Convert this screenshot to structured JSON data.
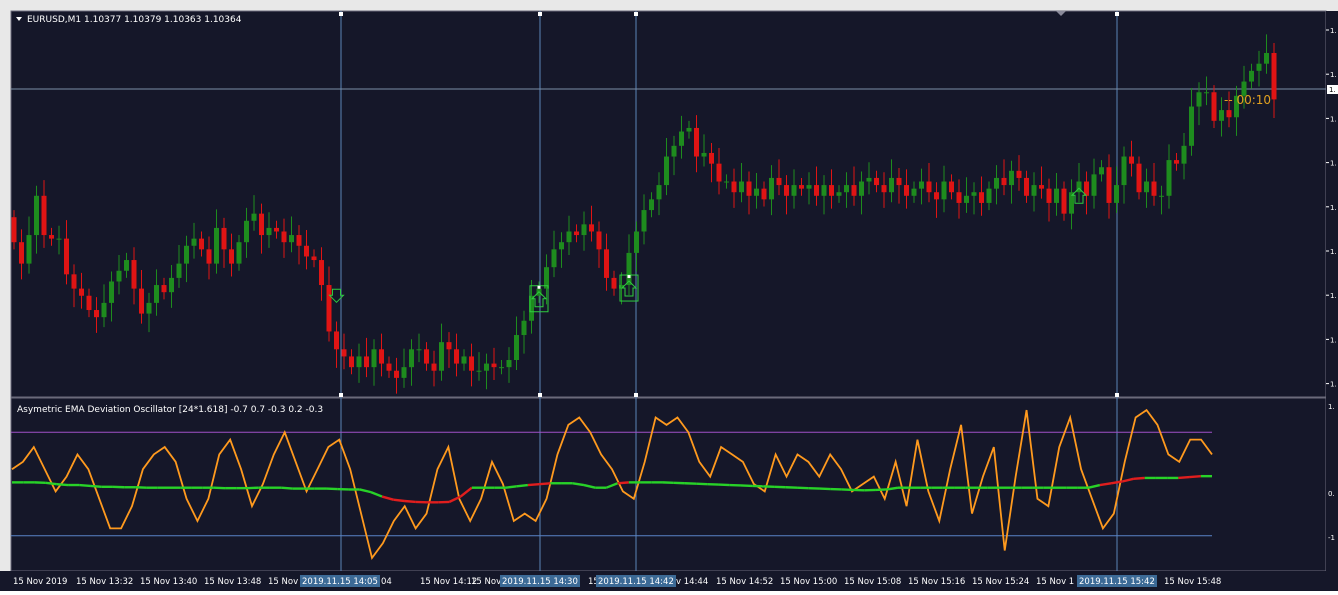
{
  "main_header": {
    "symbol": "EURUSD,M1",
    "ohlc": "1.10377 1.10379 1.10363 1.10364",
    "countdown": "-- 00:10"
  },
  "indicator_header": {
    "text": "Asymetric EMA Deviation Oscillator [24*1.618] -0.7 0.7 -0.3 0.2 -0.3"
  },
  "price_axis_labels": [
    "1.",
    "1.",
    "1.",
    "1.",
    "1.",
    "1.",
    "1.",
    "1.",
    "1."
  ],
  "current_price_label": "1.",
  "osc_axis_labels": [
    "1.",
    "0.",
    "-1"
  ],
  "time_labels": [
    "15 Nov 2019",
    "15 Nov 13:32",
    "15 Nov 13:40",
    "15 Nov 13:48",
    "15 Nov",
    "04",
    "15 Nov 14:12",
    "15 Nov 14",
    "15",
    "v 14:44",
    "15 Nov 14:52",
    "15 Nov 15:00",
    "15 Nov 15:08",
    "15 Nov 15:16",
    "15 Nov 15:24",
    "15 Nov 1",
    "15 Nov 15:48"
  ],
  "time_highlights": [
    "2019.11.15 14:05",
    "2019.11.15 14:30",
    "2019.11.15 14:42",
    "2019.11.15 15:42"
  ],
  "colors": {
    "background": "#151729",
    "bull": "#1e8c1e",
    "bear": "#e01414",
    "grid_line": "#5a84b8",
    "oscillator_fast": "#ff9a1e",
    "oscillator_slow_up": "#28d228",
    "oscillator_slow_down": "#e01e1e",
    "upper_level": "#a050c8",
    "lower_level": "#5a84c8",
    "arrow_up": "#2ecc40",
    "countdown": "#e0a020"
  },
  "chart_data": [
    {
      "type": "candlestick",
      "title": "EURUSD,M1",
      "y_relative_range": [
        0,
        1
      ],
      "note_units": "relative price, 0 = bottom of visible pane, 1 = top",
      "open": [
        0.47,
        0.4,
        0.34,
        0.42,
        0.53,
        0.42,
        0.41,
        0.41,
        0.31,
        0.27,
        0.25,
        0.21,
        0.19,
        0.23,
        0.29,
        0.32,
        0.35,
        0.27,
        0.2,
        0.23,
        0.28,
        0.26,
        0.3,
        0.34,
        0.39,
        0.41,
        0.38,
        0.34,
        0.44,
        0.38,
        0.34,
        0.4,
        0.46,
        0.48,
        0.42,
        0.44,
        0.43,
        0.4,
        0.42,
        0.39,
        0.36,
        0.35,
        0.28,
        0.15,
        0.1,
        0.08,
        0.05,
        0.08,
        0.05,
        0.1,
        0.06,
        0.04,
        0.02,
        0.05,
        0.1,
        0.1,
        0.06,
        0.04,
        0.12,
        0.1,
        0.06,
        0.08,
        0.04,
        0.04,
        0.06,
        0.05,
        0.05,
        0.07,
        0.14,
        0.18,
        0.25,
        0.27,
        0.33,
        0.38,
        0.4,
        0.43,
        0.42,
        0.45,
        0.43,
        0.38,
        0.3,
        0.27,
        0.28,
        0.37,
        0.43,
        0.49,
        0.52,
        0.56,
        0.64,
        0.67,
        0.71,
        0.72,
        0.64,
        0.65,
        0.62,
        0.57,
        0.57,
        0.54,
        0.57,
        0.53,
        0.55,
        0.52,
        0.58,
        0.56,
        0.53,
        0.56,
        0.55,
        0.56,
        0.53,
        0.56,
        0.53,
        0.54,
        0.56,
        0.53,
        0.57,
        0.58,
        0.56,
        0.54,
        0.58,
        0.56,
        0.53,
        0.55,
        0.57,
        0.54,
        0.52,
        0.57,
        0.54,
        0.51,
        0.53,
        0.54,
        0.51,
        0.55,
        0.58,
        0.56,
        0.6,
        0.58,
        0.53,
        0.56,
        0.55,
        0.51,
        0.55,
        0.48,
        0.54,
        0.57,
        0.53,
        0.59,
        0.61,
        0.51,
        0.56,
        0.64,
        0.62,
        0.54,
        0.57,
        0.53,
        0.53,
        0.63,
        0.62,
        0.67,
        0.78,
        0.82,
        0.82,
        0.74,
        0.77,
        0.75,
        0.81,
        0.85,
        0.88,
        0.9,
        0.93
      ],
      "close": [
        0.4,
        0.34,
        0.42,
        0.53,
        0.42,
        0.41,
        0.41,
        0.31,
        0.27,
        0.25,
        0.21,
        0.19,
        0.23,
        0.29,
        0.32,
        0.35,
        0.27,
        0.2,
        0.23,
        0.28,
        0.26,
        0.3,
        0.34,
        0.39,
        0.41,
        0.38,
        0.34,
        0.44,
        0.38,
        0.34,
        0.4,
        0.46,
        0.48,
        0.42,
        0.44,
        0.43,
        0.4,
        0.42,
        0.39,
        0.36,
        0.35,
        0.28,
        0.15,
        0.1,
        0.08,
        0.05,
        0.08,
        0.05,
        0.1,
        0.06,
        0.04,
        0.02,
        0.05,
        0.1,
        0.1,
        0.06,
        0.04,
        0.12,
        0.1,
        0.06,
        0.08,
        0.04,
        0.04,
        0.06,
        0.05,
        0.05,
        0.07,
        0.14,
        0.18,
        0.25,
        0.27,
        0.33,
        0.38,
        0.4,
        0.43,
        0.42,
        0.45,
        0.43,
        0.38,
        0.3,
        0.27,
        0.28,
        0.37,
        0.43,
        0.49,
        0.52,
        0.56,
        0.64,
        0.67,
        0.71,
        0.72,
        0.64,
        0.65,
        0.62,
        0.57,
        0.57,
        0.54,
        0.57,
        0.53,
        0.55,
        0.52,
        0.58,
        0.56,
        0.53,
        0.56,
        0.55,
        0.56,
        0.53,
        0.56,
        0.53,
        0.54,
        0.56,
        0.53,
        0.57,
        0.58,
        0.56,
        0.54,
        0.58,
        0.56,
        0.53,
        0.55,
        0.57,
        0.54,
        0.52,
        0.57,
        0.54,
        0.51,
        0.53,
        0.54,
        0.51,
        0.55,
        0.58,
        0.56,
        0.6,
        0.58,
        0.53,
        0.56,
        0.55,
        0.51,
        0.55,
        0.48,
        0.54,
        0.57,
        0.53,
        0.59,
        0.61,
        0.51,
        0.56,
        0.64,
        0.62,
        0.54,
        0.57,
        0.53,
        0.53,
        0.63,
        0.62,
        0.67,
        0.78,
        0.82,
        0.82,
        0.74,
        0.77,
        0.75,
        0.81,
        0.85,
        0.88,
        0.9,
        0.93,
        0.8
      ],
      "markers": [
        {
          "type": "arrow-down",
          "bar": 43
        },
        {
          "type": "arrow-up-boxed",
          "bar": 70
        },
        {
          "type": "arrow-up-boxed",
          "bar": 82
        },
        {
          "type": "arrow-up",
          "bar": 142
        }
      ]
    },
    {
      "type": "line",
      "title": "Asymetric EMA Deviation Oscillator [24*1.618]",
      "ylim": [
        -1,
        1
      ],
      "levels": [
        0.7,
        -0.7
      ],
      "series": [
        {
          "values": [
            0.2,
            0.3,
            0.5,
            0.2,
            -0.1,
            0.1,
            0.4,
            0.2,
            -0.2,
            -0.6,
            -0.6,
            -0.3,
            0.2,
            0.4,
            0.5,
            0.3,
            -0.2,
            -0.5,
            -0.2,
            0.4,
            0.6,
            0.2,
            -0.3,
            0.0,
            0.4,
            0.7,
            0.3,
            -0.1,
            0.2,
            0.5,
            0.6,
            0.2,
            -0.4,
            -1.0,
            -0.8,
            -0.5,
            -0.3,
            -0.6,
            -0.4,
            0.2,
            0.5,
            -0.2,
            -0.5,
            -0.2,
            0.3,
            0.0,
            -0.5,
            -0.4,
            -0.5,
            -0.2,
            0.4,
            0.8,
            0.9,
            0.7,
            0.4,
            0.2,
            -0.1,
            -0.2,
            0.3,
            0.9,
            0.8,
            0.9,
            0.7,
            0.3,
            0.1,
            0.5,
            0.4,
            0.3,
            0.0,
            -0.1,
            0.4,
            0.1,
            0.4,
            0.3,
            0.1,
            0.4,
            0.2,
            -0.1,
            0.0,
            0.1,
            -0.2,
            0.3,
            -0.3,
            0.6,
            -0.1,
            -0.5,
            0.2,
            0.8,
            -0.4,
            0.1,
            0.5,
            -0.9,
            0.1,
            1.0,
            -0.2,
            -0.3,
            0.5,
            0.9,
            0.2,
            -0.2,
            -0.6,
            -0.4,
            0.3,
            0.9,
            1.0,
            0.8,
            0.4,
            0.3,
            0.6,
            0.6,
            0.4
          ]
        },
        {
          "values": [
            -0.12,
            -0.12,
            -0.12,
            -0.11,
            -0.08,
            -0.06,
            -0.06,
            -0.04,
            -0.02,
            -0.02,
            -0.01,
            -0.01,
            0.0,
            0.0,
            0.0,
            0.0,
            0.0,
            0.0,
            0.0,
            0.01,
            0.01,
            0.01,
            0.0,
            0.0,
            0.0,
            0.02,
            0.02,
            0.02,
            0.02,
            0.03,
            0.04,
            0.04,
            0.1,
            0.2,
            0.27,
            0.3,
            0.32,
            0.33,
            0.33,
            0.32,
            0.2,
            0.0,
            0.0,
            0.0,
            0.0,
            -0.03,
            -0.06,
            -0.08,
            -0.1,
            -0.1,
            -0.1,
            -0.06,
            0.0,
            0.0,
            -0.1,
            -0.12,
            -0.12,
            -0.12,
            -0.12,
            -0.11,
            -0.1,
            -0.09,
            -0.08,
            -0.07,
            -0.06,
            -0.05,
            -0.04,
            -0.03,
            -0.02,
            -0.01,
            0.0,
            0.01,
            0.02,
            0.03,
            0.04,
            0.05,
            0.06,
            0.05,
            0.04,
            0.0,
            0.0,
            0.0,
            0.0,
            0.0,
            0.0,
            0.0,
            0.0,
            0.0,
            0.0,
            0.0,
            0.0,
            0.0,
            0.0,
            0.0,
            0.0,
            0.0,
            0.0,
            -0.06,
            -0.1,
            -0.14,
            -0.2,
            -0.22,
            -0.22,
            -0.22,
            -0.22,
            -0.24,
            -0.26,
            -0.26
          ]
        }
      ]
    }
  ]
}
